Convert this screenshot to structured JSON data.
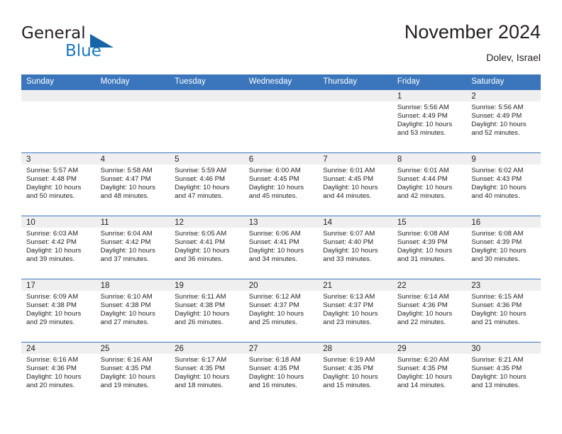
{
  "brand": {
    "name_part1": "General",
    "name_part2": "Blue",
    "accent_color": "#1878be",
    "triangle_color": "#1565a8"
  },
  "header": {
    "title": "November 2024",
    "location": "Dolev, Israel"
  },
  "theme": {
    "header_blue": "#3b76bc",
    "date_band_gray": "#efefef",
    "text_color": "#231f20"
  },
  "weekdays": [
    "Sunday",
    "Monday",
    "Tuesday",
    "Wednesday",
    "Thursday",
    "Friday",
    "Saturday"
  ],
  "weeks": [
    {
      "days": [
        {
          "date": "",
          "sunrise": "",
          "sunset": "",
          "daylight1": "",
          "daylight2": "",
          "empty": true
        },
        {
          "date": "",
          "sunrise": "",
          "sunset": "",
          "daylight1": "",
          "daylight2": "",
          "empty": true
        },
        {
          "date": "",
          "sunrise": "",
          "sunset": "",
          "daylight1": "",
          "daylight2": "",
          "empty": true
        },
        {
          "date": "",
          "sunrise": "",
          "sunset": "",
          "daylight1": "",
          "daylight2": "",
          "empty": true
        },
        {
          "date": "",
          "sunrise": "",
          "sunset": "",
          "daylight1": "",
          "daylight2": "",
          "empty": true
        },
        {
          "date": "1",
          "sunrise": "Sunrise: 5:56 AM",
          "sunset": "Sunset: 4:49 PM",
          "daylight1": "Daylight: 10 hours",
          "daylight2": "and 53 minutes."
        },
        {
          "date": "2",
          "sunrise": "Sunrise: 5:56 AM",
          "sunset": "Sunset: 4:49 PM",
          "daylight1": "Daylight: 10 hours",
          "daylight2": "and 52 minutes."
        }
      ]
    },
    {
      "days": [
        {
          "date": "3",
          "sunrise": "Sunrise: 5:57 AM",
          "sunset": "Sunset: 4:48 PM",
          "daylight1": "Daylight: 10 hours",
          "daylight2": "and 50 minutes."
        },
        {
          "date": "4",
          "sunrise": "Sunrise: 5:58 AM",
          "sunset": "Sunset: 4:47 PM",
          "daylight1": "Daylight: 10 hours",
          "daylight2": "and 48 minutes."
        },
        {
          "date": "5",
          "sunrise": "Sunrise: 5:59 AM",
          "sunset": "Sunset: 4:46 PM",
          "daylight1": "Daylight: 10 hours",
          "daylight2": "and 47 minutes."
        },
        {
          "date": "6",
          "sunrise": "Sunrise: 6:00 AM",
          "sunset": "Sunset: 4:45 PM",
          "daylight1": "Daylight: 10 hours",
          "daylight2": "and 45 minutes."
        },
        {
          "date": "7",
          "sunrise": "Sunrise: 6:01 AM",
          "sunset": "Sunset: 4:45 PM",
          "daylight1": "Daylight: 10 hours",
          "daylight2": "and 44 minutes."
        },
        {
          "date": "8",
          "sunrise": "Sunrise: 6:01 AM",
          "sunset": "Sunset: 4:44 PM",
          "daylight1": "Daylight: 10 hours",
          "daylight2": "and 42 minutes."
        },
        {
          "date": "9",
          "sunrise": "Sunrise: 6:02 AM",
          "sunset": "Sunset: 4:43 PM",
          "daylight1": "Daylight: 10 hours",
          "daylight2": "and 40 minutes."
        }
      ]
    },
    {
      "days": [
        {
          "date": "10",
          "sunrise": "Sunrise: 6:03 AM",
          "sunset": "Sunset: 4:42 PM",
          "daylight1": "Daylight: 10 hours",
          "daylight2": "and 39 minutes."
        },
        {
          "date": "11",
          "sunrise": "Sunrise: 6:04 AM",
          "sunset": "Sunset: 4:42 PM",
          "daylight1": "Daylight: 10 hours",
          "daylight2": "and 37 minutes."
        },
        {
          "date": "12",
          "sunrise": "Sunrise: 6:05 AM",
          "sunset": "Sunset: 4:41 PM",
          "daylight1": "Daylight: 10 hours",
          "daylight2": "and 36 minutes."
        },
        {
          "date": "13",
          "sunrise": "Sunrise: 6:06 AM",
          "sunset": "Sunset: 4:41 PM",
          "daylight1": "Daylight: 10 hours",
          "daylight2": "and 34 minutes."
        },
        {
          "date": "14",
          "sunrise": "Sunrise: 6:07 AM",
          "sunset": "Sunset: 4:40 PM",
          "daylight1": "Daylight: 10 hours",
          "daylight2": "and 33 minutes."
        },
        {
          "date": "15",
          "sunrise": "Sunrise: 6:08 AM",
          "sunset": "Sunset: 4:39 PM",
          "daylight1": "Daylight: 10 hours",
          "daylight2": "and 31 minutes."
        },
        {
          "date": "16",
          "sunrise": "Sunrise: 6:08 AM",
          "sunset": "Sunset: 4:39 PM",
          "daylight1": "Daylight: 10 hours",
          "daylight2": "and 30 minutes."
        }
      ]
    },
    {
      "days": [
        {
          "date": "17",
          "sunrise": "Sunrise: 6:09 AM",
          "sunset": "Sunset: 4:38 PM",
          "daylight1": "Daylight: 10 hours",
          "daylight2": "and 29 minutes."
        },
        {
          "date": "18",
          "sunrise": "Sunrise: 6:10 AM",
          "sunset": "Sunset: 4:38 PM",
          "daylight1": "Daylight: 10 hours",
          "daylight2": "and 27 minutes."
        },
        {
          "date": "19",
          "sunrise": "Sunrise: 6:11 AM",
          "sunset": "Sunset: 4:38 PM",
          "daylight1": "Daylight: 10 hours",
          "daylight2": "and 26 minutes."
        },
        {
          "date": "20",
          "sunrise": "Sunrise: 6:12 AM",
          "sunset": "Sunset: 4:37 PM",
          "daylight1": "Daylight: 10 hours",
          "daylight2": "and 25 minutes."
        },
        {
          "date": "21",
          "sunrise": "Sunrise: 6:13 AM",
          "sunset": "Sunset: 4:37 PM",
          "daylight1": "Daylight: 10 hours",
          "daylight2": "and 23 minutes."
        },
        {
          "date": "22",
          "sunrise": "Sunrise: 6:14 AM",
          "sunset": "Sunset: 4:36 PM",
          "daylight1": "Daylight: 10 hours",
          "daylight2": "and 22 minutes."
        },
        {
          "date": "23",
          "sunrise": "Sunrise: 6:15 AM",
          "sunset": "Sunset: 4:36 PM",
          "daylight1": "Daylight: 10 hours",
          "daylight2": "and 21 minutes."
        }
      ]
    },
    {
      "days": [
        {
          "date": "24",
          "sunrise": "Sunrise: 6:16 AM",
          "sunset": "Sunset: 4:36 PM",
          "daylight1": "Daylight: 10 hours",
          "daylight2": "and 20 minutes."
        },
        {
          "date": "25",
          "sunrise": "Sunrise: 6:16 AM",
          "sunset": "Sunset: 4:35 PM",
          "daylight1": "Daylight: 10 hours",
          "daylight2": "and 19 minutes."
        },
        {
          "date": "26",
          "sunrise": "Sunrise: 6:17 AM",
          "sunset": "Sunset: 4:35 PM",
          "daylight1": "Daylight: 10 hours",
          "daylight2": "and 18 minutes."
        },
        {
          "date": "27",
          "sunrise": "Sunrise: 6:18 AM",
          "sunset": "Sunset: 4:35 PM",
          "daylight1": "Daylight: 10 hours",
          "daylight2": "and 16 minutes."
        },
        {
          "date": "28",
          "sunrise": "Sunrise: 6:19 AM",
          "sunset": "Sunset: 4:35 PM",
          "daylight1": "Daylight: 10 hours",
          "daylight2": "and 15 minutes."
        },
        {
          "date": "29",
          "sunrise": "Sunrise: 6:20 AM",
          "sunset": "Sunset: 4:35 PM",
          "daylight1": "Daylight: 10 hours",
          "daylight2": "and 14 minutes."
        },
        {
          "date": "30",
          "sunrise": "Sunrise: 6:21 AM",
          "sunset": "Sunset: 4:35 PM",
          "daylight1": "Daylight: 10 hours",
          "daylight2": "and 13 minutes."
        }
      ]
    }
  ]
}
